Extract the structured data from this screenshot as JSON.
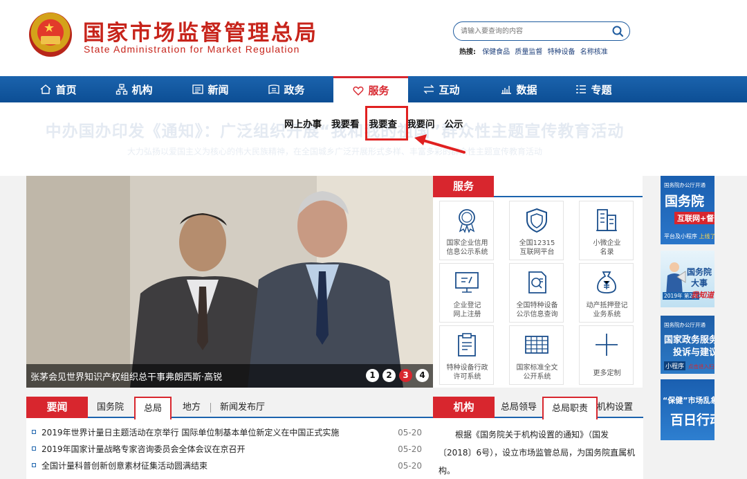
{
  "header": {
    "title_cn": "国家市场监督管理总局",
    "title_en": "State Administration for Market Regulation",
    "search_placeholder": "请输入要查询的内容",
    "hot_label": "热搜:",
    "hot_links": [
      "保健食品",
      "质量监督",
      "特种设备",
      "名称核准"
    ]
  },
  "nav": {
    "items": [
      {
        "label": "首页",
        "icon": "home-icon"
      },
      {
        "label": "机构",
        "icon": "org-chart-icon"
      },
      {
        "label": "新闻",
        "icon": "news-icon"
      },
      {
        "label": "政务",
        "icon": "affairs-icon"
      },
      {
        "label": "服务",
        "icon": "heart-icon",
        "active": true
      },
      {
        "label": "互动",
        "icon": "exchange-icon"
      },
      {
        "label": "数据",
        "icon": "chart-icon"
      },
      {
        "label": "专题",
        "icon": "list-icon"
      }
    ]
  },
  "subnav": {
    "items": [
      "网上办事",
      "我要看",
      "我要查",
      "我要问",
      "公示"
    ],
    "highlighted": "我要查"
  },
  "background_headline": "中办国办印发《通知》：广泛组织开展“我和我的祖国”群众性主题宣传教育活动",
  "background_sub": "大力弘扬以爱国主义为核心的伟大民族精神，在全国城乡广泛开展形式多样、丰富多彩的群众性主题宣传教育活动",
  "slider": {
    "caption": "张茅会见世界知识产权组织总干事弗朗西斯·高锐",
    "dots": [
      "1",
      "2",
      "3",
      "4"
    ],
    "active_dot": "3"
  },
  "service": {
    "title": "服务",
    "cells": [
      {
        "label_1": "国家企业信用",
        "label_2": "信息公示系统",
        "icon": "credit-seal-icon"
      },
      {
        "label_1": "全国12315",
        "label_2": "互联网平台",
        "icon": "shield-icon"
      },
      {
        "label_1": "小微企业",
        "label_2": "名录",
        "icon": "building-icon"
      },
      {
        "label_1": "企业登记",
        "label_2": "网上注册",
        "icon": "monitor-icon"
      },
      {
        "label_1": "全国特种设备",
        "label_2": "公示信息查询",
        "icon": "document-search-icon"
      },
      {
        "label_1": "动产抵押登记",
        "label_2": "业务系统",
        "icon": "money-bag-icon"
      },
      {
        "label_1": "特种设备行政",
        "label_2": "许可系统",
        "icon": "clipboard-icon"
      },
      {
        "label_1": "国家标准全文",
        "label_2": "公开系统",
        "icon": "table-grid-icon"
      },
      {
        "label_1": "更多定制",
        "label_2": "",
        "icon": "plus-icon"
      }
    ]
  },
  "ads": {
    "ad1": {
      "top": "国务院办公厅开通",
      "title": "国务院",
      "pill": "互联网+督查",
      "bottom": "平台及小程序",
      "tag": "上线了"
    },
    "ad2": {
      "title_1": "国务院",
      "title_2": "大事",
      "tag": "2019年 第2期",
      "sign": "我知道"
    },
    "ad3": {
      "top": "国务院办公厅开通",
      "title_1": "国家政务服务",
      "title_2": "投诉与建议",
      "tag": "小程序",
      "note": "点击进入扫码"
    },
    "ad4": {
      "title_1": "“保健”市场乱象",
      "title_2": "百日行动"
    }
  },
  "news": {
    "title": "要闻",
    "tabs": [
      "国务院",
      "总局",
      "地方",
      "新闻发布厅"
    ],
    "active_tab": "总局",
    "rows": [
      {
        "title": "2019年世界计量日主题活动在京举行 国际单位制基本单位新定义在中国正式实施",
        "date": "05-20"
      },
      {
        "title": "2019年国家计量战略专家咨询委员会全体会议在京召开",
        "date": "05-20"
      },
      {
        "title": "全国计量科普创新创意素材征集活动圆满结束",
        "date": "05-20"
      }
    ]
  },
  "org": {
    "title": "机构",
    "tabs": [
      "总局领导",
      "总局职责",
      "机构设置"
    ],
    "active_tab": "总局职责",
    "text": "根据《国务院关于机构设置的通知》（国发〔2018〕6号），设立市场监管总局，为国务院直属机构。"
  },
  "colors": {
    "brand_red": "#d8262e",
    "nav_blue": "#1b63ad",
    "logo_red": "#c7241b"
  }
}
